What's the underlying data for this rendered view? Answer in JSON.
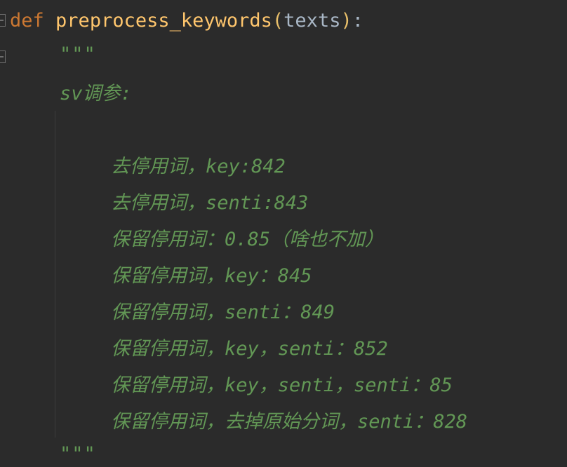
{
  "code": {
    "def_keyword": "def",
    "function_name": "preprocess_keywords",
    "open_paren": "(",
    "param": "texts",
    "close_paren": ")",
    "colon": ":",
    "docstring_open": "\"\"\"",
    "docstring_close": "\"\"\"",
    "doc_lines": [
      "sv调参:",
      "去停用词，key:842",
      "去停用词，senti:843",
      "保留停用词：0.85（啥也不加）",
      "保留停用词，key：845",
      "保留停用词，senti：849",
      "保留停用词，key，senti：852",
      "保留停用词，key，senti，senti：85",
      "保留停用词，去掉原始分词，senti：828"
    ]
  },
  "colors": {
    "background": "#2b2b2b",
    "keyword": "#cc7832",
    "function": "#ffc66d",
    "docstring": "#629755",
    "parameter": "#a9b7c6"
  }
}
